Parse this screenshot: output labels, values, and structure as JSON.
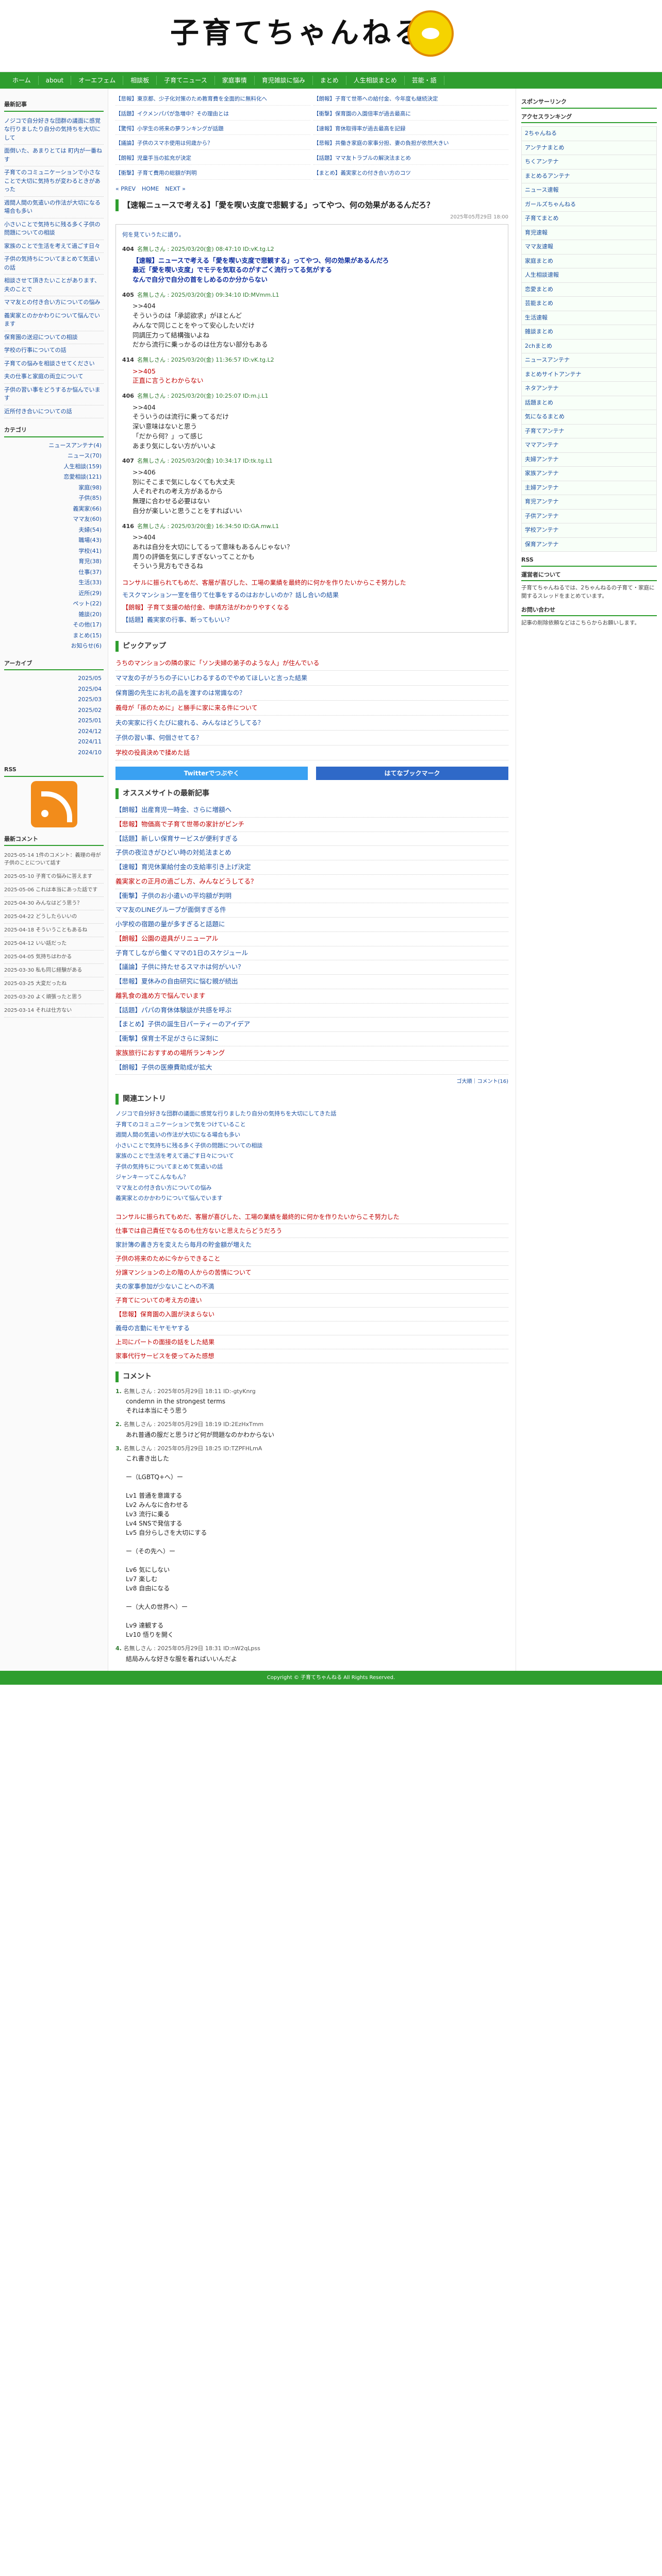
{
  "site": {
    "title": "子育てちゃんねる"
  },
  "nav": {
    "items": [
      "ホーム",
      "about",
      "オーエフェム",
      "相談板",
      "子育てニュース",
      "家庭事情",
      "育児雑談に悩み",
      "まとめ",
      "人生相談まとめ",
      "芸能・語"
    ]
  },
  "left": {
    "news_title": "最新記事",
    "news": [
      "ノジコで自分好きな団群の議面に感覚な行りましたり自分の気持ちを大切にして",
      "面倒いた、あまりとては 町内が一番ねす",
      "子育てのコミュニケーションで小さなことで大切に気持ちが変わるときがあった",
      "週間人間の気遣いの作法が大切になる場合も多い",
      "小さいことで気持ちに残る多く子供の問題についての相談",
      "家族のことで生活を考えて過ごす日々",
      "子供の気持ちについてまとめて気遣いの話",
      "相談させて頂きたいことがあります、夫のことで",
      "ママ友との付き合い方についての悩み",
      "義実家とのかかわりについて悩んでいます",
      "保育園の送迎についての相談",
      "学校の行事についての話",
      "子育ての悩みを相談させてください",
      "夫の仕事と家庭の両立について",
      "子供の習い事をどうするか悩んでいます",
      "近所付き合いについての話"
    ],
    "cat_title": "カテゴリ",
    "cats": [
      "ニュースアンテナ(4)",
      "ニュース(70)",
      "人生相談(159)",
      "恋愛相談(121)",
      "家庭(98)",
      "子供(85)",
      "義実家(66)",
      "ママ友(60)",
      "夫婦(54)",
      "職場(43)",
      "学校(41)",
      "育児(38)",
      "仕事(37)",
      "生活(33)",
      "近所(29)",
      "ペット(22)",
      "雑談(20)",
      "その他(17)",
      "まとめ(15)",
      "お知らせ(6)"
    ],
    "arch_title": "アーカイブ",
    "archives": [
      "2025/05",
      "2025/04",
      "2025/03",
      "2025/02",
      "2025/01",
      "2024/12",
      "2024/11",
      "2024/10"
    ],
    "rss_title": "RSS",
    "rc_title": "最新コメント",
    "recent_comments": [
      "2025-05-14 1件のコメント：義理の母が子供のことについて話す",
      "2025-05-10 子育ての悩みに答えます",
      "2025-05-06 これは本当にあった話です",
      "2025-04-30 みんなはどう思う？",
      "2025-04-22 どうしたらいいの",
      "2025-04-18 そういうこともあるね",
      "2025-04-12 いい話だった",
      "2025-04-05 気持ちはわかる",
      "2025-03-30 私も同じ経験がある",
      "2025-03-25 大変だったね",
      "2025-03-20 よく頑張ったと思う",
      "2025-03-14 それは仕方ない"
    ]
  },
  "promo": [
    "【悲報】東京都、少子化対策のため教育費を全面的に無料化へ",
    "【朗報】子育て世帯への給付金、今年度も継続決定",
    "【話題】イクメンパパが急増中？その理由とは",
    "【衝撃】保育園の入園倍率が過去最高に",
    "【驚愕】小学生の将来の夢ランキングが話題",
    "【速報】育休取得率が過去最高を記録",
    "【議論】子供のスマホ使用は何歳から？",
    "【悲報】共働き家庭の家事分担、妻の負担が依然大きい",
    "【朗報】児童手当の拡充が決定",
    "【話題】ママ友トラブルの解決法まとめ",
    "【衝撃】子育て費用の総額が判明",
    "【まとめ】義実家との付き合い方のコツ"
  ],
  "pager": [
    "« PREV",
    "HOME",
    "NEXT »"
  ],
  "article": {
    "title": "【速報ニュースで考える】「愛を喫い支度で悲観する」ってやつ、何の効果があるんだろ？",
    "date": "2025年05月29日 18:00",
    "intro": "何を見ていうたに語り。",
    "posts": [
      {
        "num": "404",
        "head": "名無しさん : 2025/03/20(金) 08:47:10 ID:vK.tg.L2",
        "body": "【速報】ニュースで考える「愛を喫い支度で悲観する」ってやつ、何の効果があるんだろ\n最近「愛を喫い支度」でモテを気取るのがすごく流行ってる気がする\nなんで自分で自分の首をしめるのか分からない",
        "style": "blue"
      },
      {
        "num": "405",
        "head": "名無しさん : 2025/03/20(金) 09:34:10 ID:MVmm.L1",
        "body": ">>404\nそういうのは「承認欲求」がほとんど\nみんなで同じことをやって安心したいだけ\n同調圧力って結構強いよね\nだから流行に乗っかるのは仕方ない部分もある",
        "style": ""
      },
      {
        "num": "414",
        "head": "名無しさん : 2025/03/20(金) 11:36:57 ID:vK.tg.L2",
        "body": ">>405\n正直に言うとわからない",
        "style": "red"
      },
      {
        "num": "406",
        "head": "名無しさん : 2025/03/20(金) 10:25:07 ID:m.j.L1",
        "body": ">>404\nそういうのは流行に乗ってるだけ\n深い意味はないと思う\n「だから何？」って感じ\nあまり気にしない方がいいよ",
        "style": ""
      },
      {
        "num": "407",
        "head": "名無しさん : 2025/03/20(金) 10:34:17 ID:tk.tg.L1",
        "body": ">>406\n別にそこまで気にしなくても大丈夫\n人それぞれの考え方があるから\n無理に合わせる必要はない\n自分が楽しいと思うことをすればいい",
        "style": ""
      },
      {
        "num": "416",
        "head": "名無しさん : 2025/03/20(金) 16:34:50 ID:GA.mw.L1",
        "body": ">>404\nあれは自分を大切にしてるって意味もあるんじゃない？\n周りの評価を気にしすぎないってことかも\nそういう見方もできるね",
        "style": ""
      }
    ],
    "ads": [
      "コンサルに振られてもめだ、客層が喜びした、工場の業績を最終的に何かを作りたいからこそ努力した",
      "モスクマンション一室を借りて仕事をするのはおかしいのか？話し合いの結果",
      "【朗報】子育て支援の給付金、申請方法がわかりやすくなる",
      "【話題】義実家の行事、断ってもいい？"
    ]
  },
  "pickup": {
    "title": "ピックアップ",
    "items": [
      "うちのマンションの隣の家に「ソン夫婦の弟子のような人」が住んでいる",
      "ママ友の子がうちの子にいじわるするのでやめてほしいと言った結果",
      "保育園の先生にお礼の品を渡すのは常識なの？",
      "義母が「孫のために」と勝手に家に来る件について",
      "夫の実家に行くたびに疲れる、みんなはどうしてる？",
      "子供の習い事、何個させてる？",
      "学校の役員決めで揉めた話"
    ]
  },
  "social": {
    "twitter": "Twitterでつぶやく",
    "hatena": "はてなブックマーク"
  },
  "osusume": {
    "title": "オススメサイトの最新記事",
    "items": [
      "【朗報】出産育児一時金、さらに増額へ",
      "【悲報】物価高で子育て世帯の家計がピンチ",
      "【話題】新しい保育サービスが便利すぎる",
      "子供の夜泣きがひどい時の対処法まとめ",
      "【速報】育児休業給付金の支給率引き上げ決定",
      "義実家との正月の過ごし方、みんなどうしてる？",
      "【衝撃】子供のお小遣いの平均額が判明",
      "ママ友のLINEグループが面倒すぎる件",
      "小学校の宿題の量が多すぎると話題に",
      "【朗報】公園の遊具がリニューアル",
      "子育てしながら働くママの1日のスケジュール",
      "【議論】子供に持たせるスマホは何がいい？",
      "【悲報】夏休みの自由研究に悩む親が続出",
      "離乳食の進め方で悩んでいます",
      "【話題】パパの育休体験談が共感を呼ぶ",
      "【まとめ】子供の誕生日パーティーのアイデア",
      "【衝撃】保育士不足がさらに深刻に",
      "家族旅行におすすめの場所ランキング",
      "【朗報】子供の医療費助成が拡大"
    ],
    "meta": "ゴ大順｜コメント(16)"
  },
  "related": {
    "title": "関連エントリ",
    "items": [
      "ノジコで自分好きな団群の議面に感覚な行りましたり自分の気持ちを大切にしてきた話",
      "子育てのコミュニケーションで気をつけていること",
      "週間人間の気遣いの作法が大切になる場合も多い",
      "小さいことで気持ちに残る多く子供の問題についての相談",
      "家族のことで生活を考えて過ごす日々について",
      "子供の気持ちについてまとめて気遣いの話",
      "ジャンキーってこんなもん？",
      "ママ友との付き合い方についての悩み",
      "義実家とのかかわりについて悩んでいます"
    ],
    "items2": [
      "コンサルに振られてもめだ、客層が喜びした、工場の業績を最終的に何かを作りたいからこそ努力した",
      "仕事では自己責任でなるのも仕方ないと思えたらどうだろう",
      "家計簿の書き方を変えたら毎月の貯金額が増えた",
      "子供の将来のために今からできること",
      "分譲マンションの上の階の人からの苦情について",
      "夫の家事参加が少ないことへの不満",
      "子育てについての考え方の違い",
      "【悲報】保育園の入園が決まらない",
      "義母の言動にモヤモヤする",
      "上司にパートの面接の話をした結果",
      "家事代行サービスを使ってみた感想"
    ]
  },
  "comments": {
    "title": "コメント",
    "items": [
      {
        "num": "1.",
        "head": "名無しさん : 2025年05月29日 18:11 ID:-gtyKnrg",
        "body": "condemn in the strongest terms\nそれは本当にそう思う"
      },
      {
        "num": "2.",
        "head": "名無しさん : 2025年05月29日 18:19 ID:2EzHxTmm",
        "body": "あれ普通の服だと思うけど何が問題なのかわからない"
      },
      {
        "num": "3.",
        "head": "名無しさん : 2025年05月29日 18:25 ID:TZPFHLmA",
        "body": "これ書き出した\n\nー（LGBTQ+へ）ー\n\nLv1 普通を意識する\nLv2 みんなに合わせる\nLv3 流行に乗る\nLv4 SNSで発信する\nLv5 自分らしさを大切にする\n\nー（その先へ）ー\n\nLv6 気にしない\nLv7 楽しむ\nLv8 自由になる\n\nー（大人の世界へ）ー\n\nLv9 達観する\nLv10 悟りを開く"
      },
      {
        "num": "4.",
        "head": "名無しさん : 2025年05月29日 18:31 ID:nW2qLpss",
        "body": "結局みんな好きな服を着ればいいんだよ"
      }
    ]
  },
  "right": {
    "search_title": "スポンサーリンク",
    "antenna_title": "アクセスランキング",
    "links": [
      "2ちゃんねる",
      "アンテナまとめ",
      "ちくアンテナ",
      "まとめるアンテナ",
      "ニュース速報",
      "ガールズちゃんねる",
      "子育てまとめ",
      "育児速報",
      "ママ友速報",
      "家庭まとめ",
      "人生相談速報",
      "恋愛まとめ",
      "芸能まとめ",
      "生活速報",
      "雑談まとめ",
      "2chまとめ",
      "ニュースアンテナ",
      "まとめサイトアンテナ",
      "ネタアンテナ",
      "話題まとめ",
      "気になるまとめ",
      "子育てアンテナ",
      "ママアンテナ",
      "夫婦アンテナ",
      "家族アンテナ",
      "主婦アンテナ",
      "育児アンテナ",
      "子供アンテナ",
      "学校アンテナ",
      "保育アンテナ"
    ],
    "rss_title": "RSS",
    "about_title": "運営者について",
    "about_text": "子育てちゃんねるでは、2ちゃんねるの子育て・家庭に関するスレッドをまとめています。",
    "contact_title": "お問い合わせ",
    "contact_text": "記事の削除依頼などはこちらからお願いします。"
  },
  "footer": "Copyright © 子育てちゃんねる All Rights Reserved."
}
